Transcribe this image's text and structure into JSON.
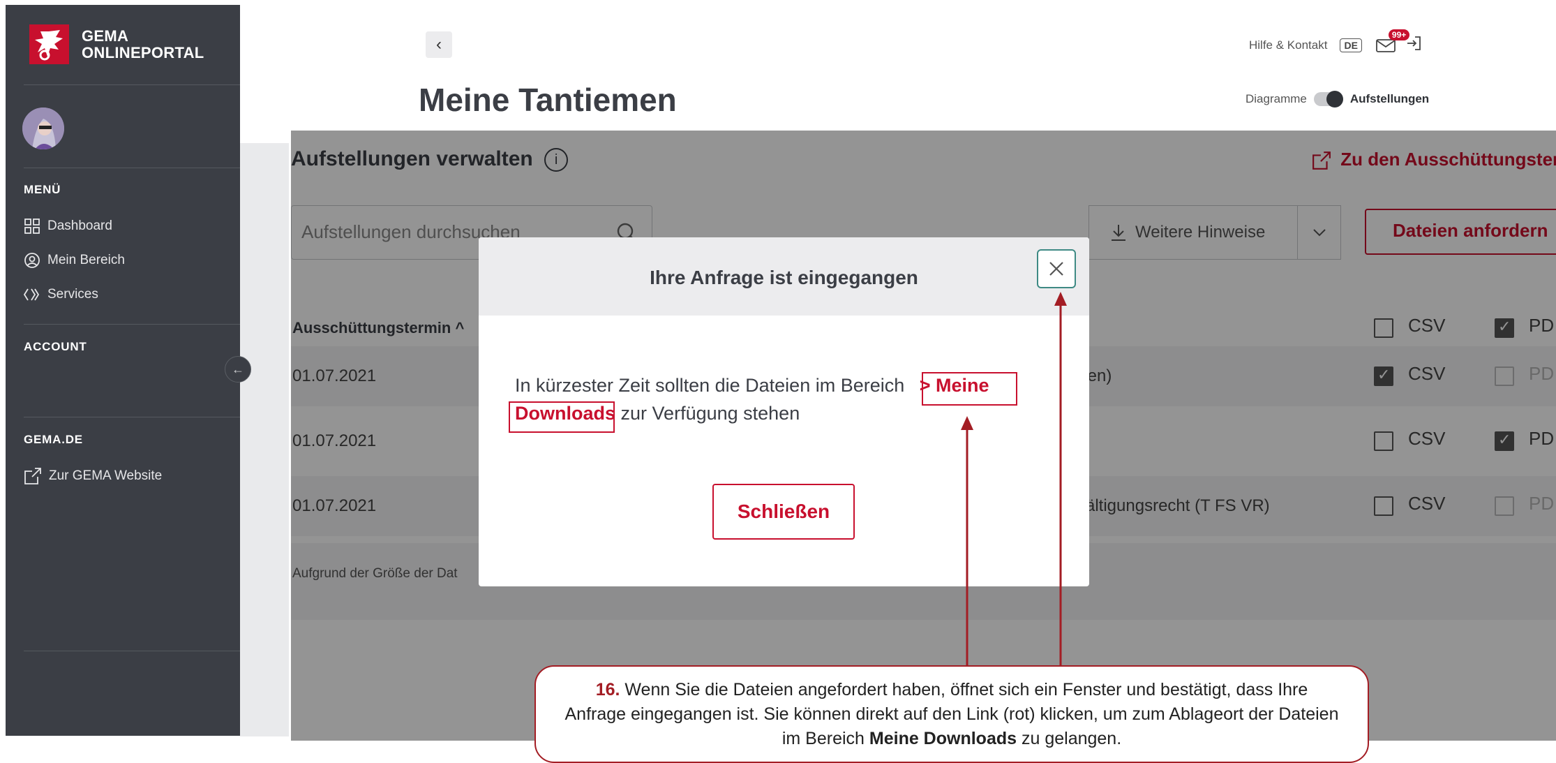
{
  "sidebar": {
    "brand_line1": "GEMA",
    "brand_line2": "ONLINEPORTAL",
    "menu_heading": "MENÜ",
    "items": [
      {
        "label": "Dashboard",
        "icon": "grid-icon"
      },
      {
        "label": "Mein Bereich",
        "icon": "user-circle-icon"
      },
      {
        "label": "Services",
        "icon": "services-icon"
      }
    ],
    "account_heading": "ACCOUNT",
    "gema_heading": "GEMA.DE",
    "website_link": "Zur GEMA Website",
    "collapse_icon": "arrow-left-icon"
  },
  "header": {
    "help": "Hilfe & Kontakt",
    "lang": "DE",
    "mail_badge": "99+",
    "page_title": "Meine Tantiemen",
    "toggle_left": "Diagramme",
    "toggle_right": "Aufstellungen"
  },
  "content": {
    "title": "Aufstellungen verwalten",
    "info_icon": "info-icon",
    "ext_link": "Zu den Ausschüttungster",
    "search_placeholder": "Aufstellungen durchsuchen",
    "hinweise": "Weitere Hinweise",
    "request_button": "Dateien anfordern",
    "column_header": "Ausschüttungstermin ^",
    "csv_label": "CSV",
    "pdf_label": "PD",
    "rows": [
      {
        "date": "01.07.2021",
        "desc": "rten)",
        "csv": true,
        "pdf": false
      },
      {
        "date": "01.07.2021",
        "desc": "",
        "csv": false,
        "pdf": true
      },
      {
        "date": "01.07.2021",
        "desc": "lfältigungsrecht (T FS VR)",
        "csv": false,
        "pdf": false
      }
    ],
    "header_checks": {
      "csv": false,
      "pdf": true
    },
    "note": "Aufgrund der Größe der Dat"
  },
  "modal": {
    "title": "Ihre Anfrage ist eingegangen",
    "body_before": "In kürzester Zeit sollten die Dateien im Bereich",
    "link_part1": "> Meine",
    "link_part2": "Downloads",
    "body_after": "zur Verfügung stehen",
    "close_button": "Schließen"
  },
  "callout": {
    "number": "16.",
    "text_1": " Wenn Sie die Dateien angefordert haben, öffnet sich ein Fenster und bestätigt, dass Ihre Anfrage eingegangen ist. Sie können direkt auf den Link (rot) klicken, um zum Ablageort der Dateien im Bereich ",
    "bold": "Meine Downloads",
    "text_2": " zu gelangen."
  },
  "colors": {
    "accent": "#c8102e",
    "sidebar": "#3b3e45",
    "close_border": "#3e8a84"
  }
}
